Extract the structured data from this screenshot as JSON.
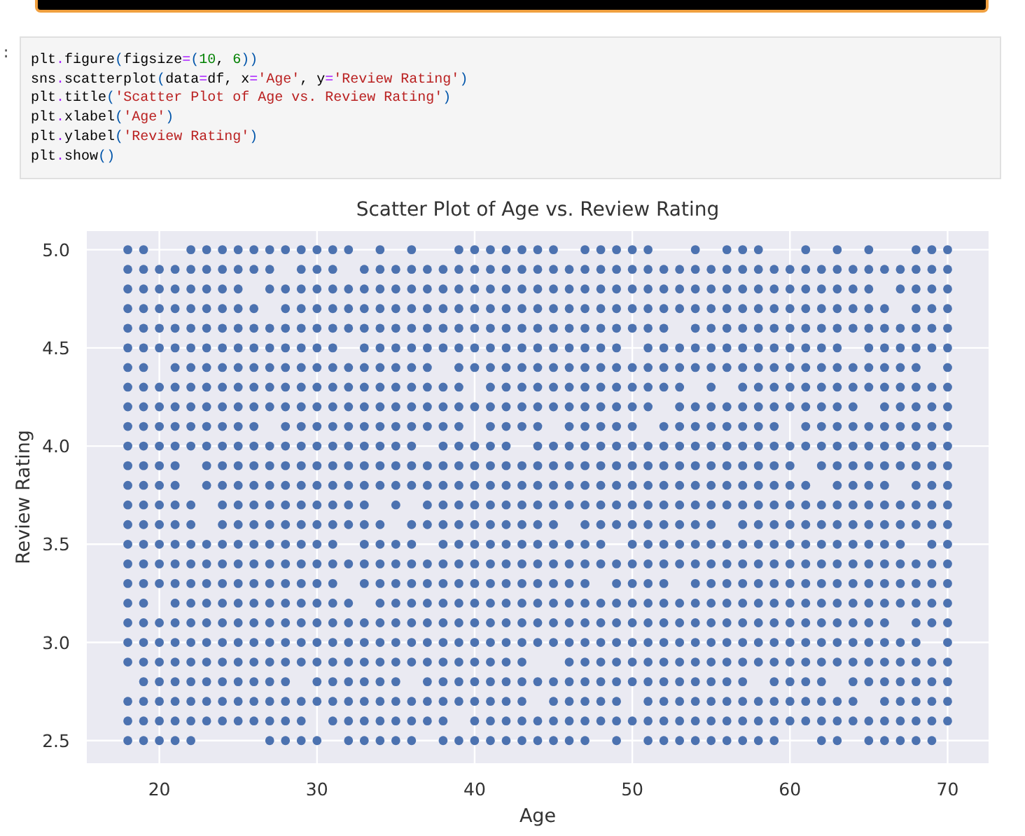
{
  "cell": {
    "prompt": ":",
    "code": [
      "plt.figure(figsize=(10, 6))",
      "sns.scatterplot(data=df, x='Age', y='Review Rating')",
      "plt.title('Scatter Plot of Age vs. Review Rating')",
      "plt.xlabel('Age')",
      "plt.ylabel('Review Rating')",
      "plt.show()"
    ]
  },
  "chart_data": {
    "type": "scatter",
    "title": "Scatter Plot of Age vs. Review Rating",
    "xlabel": "Age",
    "ylabel": "Review Rating",
    "x": [
      18,
      19,
      20,
      21,
      22,
      23,
      24,
      25,
      26,
      27,
      28,
      29,
      30,
      31,
      32,
      33,
      34,
      35,
      36,
      37,
      38,
      39,
      40,
      41,
      42,
      43,
      44,
      45,
      46,
      47,
      48,
      49,
      50,
      51,
      52,
      53,
      54,
      55,
      56,
      57,
      58,
      59,
      60,
      61,
      62,
      63,
      64,
      65,
      66,
      67,
      68,
      69,
      70
    ],
    "grid": true,
    "xlim": [
      15.4,
      72.6
    ],
    "ylim": [
      2.385,
      5.095
    ],
    "xticks": [
      20,
      30,
      40,
      50,
      60,
      70
    ],
    "yticks": [
      {
        "value": 2.5,
        "label": "2.5"
      },
      {
        "value": 3,
        "label": "3.0"
      },
      {
        "value": 3.5,
        "label": "3.5"
      },
      {
        "value": 4,
        "label": "4.0"
      },
      {
        "value": 4.5,
        "label": "4.5"
      },
      {
        "value": 5,
        "label": "5.0"
      }
    ],
    "series": [
      {
        "color": "#4c72b0",
        "values": [
          5,
          5,
          null,
          null,
          5,
          5,
          5,
          5,
          5,
          5,
          5,
          5,
          5,
          5,
          5,
          null,
          5,
          null,
          5,
          null,
          null,
          5,
          5,
          5,
          5,
          5,
          5,
          5,
          null,
          5,
          5,
          5,
          5,
          5,
          null,
          null,
          5,
          null,
          5,
          5,
          5,
          null,
          null,
          5,
          null,
          5,
          null,
          5,
          null,
          null,
          5,
          5,
          5
        ]
      },
      {
        "color": "#4c72b0",
        "values": [
          4.9,
          4.9,
          4.9,
          4.9,
          4.9,
          4.9,
          4.9,
          4.9,
          4.9,
          4.9,
          null,
          4.9,
          4.9,
          4.9,
          null,
          4.9,
          4.9,
          4.9,
          4.9,
          4.9,
          4.9,
          4.9,
          4.9,
          4.9,
          4.9,
          4.9,
          4.9,
          4.9,
          4.9,
          4.9,
          4.9,
          4.9,
          4.9,
          4.9,
          4.9,
          4.9,
          4.9,
          4.9,
          4.9,
          4.9,
          4.9,
          4.9,
          4.9,
          4.9,
          4.9,
          4.9,
          4.9,
          4.9,
          4.9,
          4.9,
          4.9,
          4.9,
          4.9
        ]
      },
      {
        "color": "#4c72b0",
        "values": [
          4.8,
          4.8,
          4.8,
          4.8,
          4.8,
          4.8,
          4.8,
          4.8,
          null,
          4.8,
          4.8,
          4.8,
          4.8,
          4.8,
          4.8,
          4.8,
          4.8,
          4.8,
          4.8,
          4.8,
          4.8,
          4.8,
          4.8,
          4.8,
          4.8,
          4.8,
          4.8,
          4.8,
          4.8,
          4.8,
          4.8,
          4.8,
          4.8,
          4.8,
          4.8,
          4.8,
          4.8,
          4.8,
          4.8,
          4.8,
          4.8,
          4.8,
          4.8,
          4.8,
          4.8,
          4.8,
          4.8,
          4.8,
          null,
          4.8,
          4.8,
          4.8,
          4.8
        ]
      },
      {
        "color": "#4c72b0",
        "values": [
          4.7,
          4.7,
          4.7,
          4.7,
          4.7,
          4.7,
          4.7,
          4.7,
          4.7,
          null,
          4.7,
          4.7,
          4.7,
          4.7,
          4.7,
          4.7,
          4.7,
          4.7,
          4.7,
          4.7,
          4.7,
          4.7,
          4.7,
          4.7,
          4.7,
          4.7,
          4.7,
          4.7,
          4.7,
          4.7,
          4.7,
          4.7,
          4.7,
          4.7,
          4.7,
          4.7,
          4.7,
          4.7,
          4.7,
          4.7,
          4.7,
          4.7,
          4.7,
          4.7,
          4.7,
          4.7,
          4.7,
          4.7,
          4.7,
          null,
          4.7,
          4.7,
          4.7
        ]
      },
      {
        "color": "#4c72b0",
        "values": [
          4.6,
          4.6,
          4.6,
          4.6,
          4.6,
          4.6,
          4.6,
          4.6,
          4.6,
          4.6,
          4.6,
          4.6,
          4.6,
          4.6,
          4.6,
          4.6,
          4.6,
          4.6,
          4.6,
          4.6,
          4.6,
          4.6,
          4.6,
          4.6,
          4.6,
          4.6,
          4.6,
          4.6,
          4.6,
          4.6,
          4.6,
          4.6,
          4.6,
          4.6,
          4.6,
          null,
          4.6,
          4.6,
          4.6,
          4.6,
          4.6,
          4.6,
          4.6,
          4.6,
          4.6,
          4.6,
          4.6,
          4.6,
          4.6,
          4.6,
          4.6,
          4.6,
          4.6
        ]
      },
      {
        "color": "#4c72b0",
        "values": [
          4.5,
          4.5,
          4.5,
          4.5,
          4.5,
          4.5,
          4.5,
          4.5,
          4.5,
          4.5,
          4.5,
          4.5,
          4.5,
          4.5,
          null,
          4.5,
          4.5,
          4.5,
          4.5,
          4.5,
          4.5,
          4.5,
          4.5,
          4.5,
          4.5,
          4.5,
          4.5,
          4.5,
          4.5,
          4.5,
          4.5,
          4.5,
          null,
          4.5,
          4.5,
          4.5,
          4.5,
          4.5,
          4.5,
          4.5,
          4.5,
          4.5,
          4.5,
          4.5,
          4.5,
          4.5,
          null,
          4.5,
          4.5,
          4.5,
          4.5,
          4.5,
          4.5
        ]
      },
      {
        "color": "#4c72b0",
        "values": [
          4.4,
          4.4,
          null,
          4.4,
          4.4,
          4.4,
          4.4,
          4.4,
          4.4,
          4.4,
          4.4,
          4.4,
          4.4,
          4.4,
          4.4,
          4.4,
          4.4,
          4.4,
          4.4,
          4.4,
          null,
          4.4,
          4.4,
          4.4,
          4.4,
          4.4,
          4.4,
          4.4,
          4.4,
          4.4,
          4.4,
          4.4,
          4.4,
          4.4,
          4.4,
          4.4,
          4.4,
          4.4,
          4.4,
          4.4,
          4.4,
          4.4,
          4.4,
          4.4,
          4.4,
          4.4,
          4.4,
          4.4,
          4.4,
          4.4,
          4.4,
          null,
          4.4
        ]
      },
      {
        "color": "#4c72b0",
        "values": [
          4.3,
          4.3,
          4.3,
          4.3,
          4.3,
          4.3,
          4.3,
          4.3,
          4.3,
          4.3,
          4.3,
          4.3,
          4.3,
          4.3,
          4.3,
          4.3,
          4.3,
          4.3,
          4.3,
          4.3,
          4.3,
          4.3,
          null,
          4.3,
          4.3,
          4.3,
          4.3,
          4.3,
          4.3,
          4.3,
          4.3,
          4.3,
          4.3,
          4.3,
          4.3,
          4.3,
          null,
          4.3,
          null,
          4.3,
          4.3,
          4.3,
          4.3,
          4.3,
          4.3,
          4.3,
          4.3,
          4.3,
          4.3,
          4.3,
          4.3,
          4.3,
          4.3
        ]
      },
      {
        "color": "#4c72b0",
        "values": [
          4.2,
          4.2,
          4.2,
          4.2,
          4.2,
          4.2,
          4.2,
          4.2,
          4.2,
          4.2,
          4.2,
          4.2,
          4.2,
          4.2,
          4.2,
          4.2,
          4.2,
          4.2,
          4.2,
          4.2,
          4.2,
          4.2,
          4.2,
          4.2,
          4.2,
          4.2,
          4.2,
          4.2,
          4.2,
          4.2,
          4.2,
          4.2,
          4.2,
          4.2,
          null,
          4.2,
          4.2,
          4.2,
          4.2,
          4.2,
          4.2,
          4.2,
          4.2,
          4.2,
          4.2,
          4.2,
          4.2,
          null,
          4.2,
          4.2,
          4.2,
          4.2,
          4.2
        ]
      },
      {
        "color": "#4c72b0",
        "values": [
          4.1,
          4.1,
          4.1,
          4.1,
          4.1,
          4.1,
          4.1,
          4.1,
          4.1,
          null,
          4.1,
          4.1,
          4.1,
          4.1,
          4.1,
          4.1,
          4.1,
          4.1,
          4.1,
          4.1,
          4.1,
          4.1,
          null,
          4.1,
          4.1,
          4.1,
          4.1,
          null,
          4.1,
          4.1,
          4.1,
          4.1,
          4.1,
          null,
          4.1,
          4.1,
          4.1,
          4.1,
          4.1,
          4.1,
          4.1,
          4.1,
          null,
          4.1,
          4.1,
          4.1,
          4.1,
          4.1,
          4.1,
          4.1,
          4.1,
          4.1,
          4.1
        ]
      },
      {
        "color": "#4c72b0",
        "values": [
          4,
          4,
          4,
          4,
          4,
          4,
          4,
          4,
          4,
          4,
          4,
          4,
          4,
          4,
          4,
          4,
          4,
          4,
          4,
          null,
          4,
          4,
          4,
          4,
          4,
          null,
          4,
          4,
          4,
          4,
          4,
          4,
          4,
          4,
          4,
          4,
          4,
          4,
          4,
          4,
          4,
          4,
          4,
          4,
          4,
          4,
          4,
          4,
          4,
          4,
          4,
          4,
          4
        ]
      },
      {
        "color": "#4c72b0",
        "values": [
          3.9,
          3.9,
          3.9,
          3.9,
          null,
          3.9,
          3.9,
          3.9,
          3.9,
          3.9,
          3.9,
          3.9,
          3.9,
          3.9,
          3.9,
          3.9,
          3.9,
          3.9,
          3.9,
          3.9,
          3.9,
          3.9,
          3.9,
          3.9,
          3.9,
          3.9,
          3.9,
          3.9,
          3.9,
          3.9,
          3.9,
          3.9,
          3.9,
          3.9,
          3.9,
          3.9,
          3.9,
          3.9,
          3.9,
          3.9,
          3.9,
          3.9,
          3.9,
          null,
          3.9,
          3.9,
          3.9,
          3.9,
          3.9,
          3.9,
          3.9,
          3.9,
          3.9
        ]
      },
      {
        "color": "#4c72b0",
        "values": [
          3.8,
          3.8,
          3.8,
          3.8,
          null,
          3.8,
          3.8,
          3.8,
          3.8,
          3.8,
          3.8,
          3.8,
          3.8,
          3.8,
          3.8,
          3.8,
          3.8,
          3.8,
          3.8,
          3.8,
          3.8,
          3.8,
          3.8,
          3.8,
          3.8,
          3.8,
          3.8,
          3.8,
          3.8,
          3.8,
          3.8,
          3.8,
          3.8,
          3.8,
          3.8,
          3.8,
          3.8,
          3.8,
          3.8,
          3.8,
          3.8,
          3.8,
          3.8,
          3.8,
          null,
          3.8,
          3.8,
          3.8,
          3.8,
          null,
          3.8,
          3.8,
          3.8
        ]
      },
      {
        "color": "#4c72b0",
        "values": [
          3.7,
          3.7,
          3.7,
          3.7,
          3.7,
          null,
          3.7,
          3.7,
          3.7,
          3.7,
          3.7,
          3.7,
          3.7,
          3.7,
          3.7,
          3.7,
          null,
          3.7,
          null,
          3.7,
          3.7,
          3.7,
          3.7,
          3.7,
          3.7,
          3.7,
          3.7,
          3.7,
          3.7,
          3.7,
          3.7,
          3.7,
          3.7,
          3.7,
          3.7,
          3.7,
          3.7,
          3.7,
          3.7,
          3.7,
          3.7,
          3.7,
          3.7,
          3.7,
          3.7,
          3.7,
          3.7,
          3.7,
          3.7,
          3.7,
          3.7,
          3.7,
          3.7
        ]
      },
      {
        "color": "#4c72b0",
        "values": [
          3.6,
          3.6,
          3.6,
          3.6,
          3.6,
          null,
          3.6,
          3.6,
          3.6,
          3.6,
          3.6,
          3.6,
          3.6,
          3.6,
          3.6,
          3.6,
          3.6,
          null,
          3.6,
          3.6,
          3.6,
          3.6,
          3.6,
          3.6,
          3.6,
          3.6,
          3.6,
          3.6,
          null,
          3.6,
          3.6,
          3.6,
          3.6,
          3.6,
          3.6,
          3.6,
          3.6,
          3.6,
          null,
          3.6,
          3.6,
          3.6,
          3.6,
          3.6,
          3.6,
          3.6,
          3.6,
          3.6,
          3.6,
          3.6,
          3.6,
          3.6,
          3.6
        ]
      },
      {
        "color": "#4c72b0",
        "values": [
          3.5,
          3.5,
          3.5,
          3.5,
          3.5,
          3.5,
          3.5,
          3.5,
          3.5,
          3.5,
          3.5,
          3.5,
          3.5,
          3.5,
          null,
          3.5,
          3.5,
          3.5,
          3.5,
          null,
          3.5,
          3.5,
          3.5,
          3.5,
          3.5,
          3.5,
          3.5,
          3.5,
          3.5,
          3.5,
          3.5,
          null,
          3.5,
          3.5,
          3.5,
          3.5,
          3.5,
          3.5,
          3.5,
          3.5,
          3.5,
          3.5,
          3.5,
          3.5,
          3.5,
          3.5,
          3.5,
          3.5,
          3.5,
          3.5,
          null,
          3.5,
          3.5
        ]
      },
      {
        "color": "#4c72b0",
        "values": [
          3.4,
          3.4,
          3.4,
          3.4,
          3.4,
          3.4,
          3.4,
          3.4,
          3.4,
          3.4,
          3.4,
          3.4,
          3.4,
          3.4,
          3.4,
          3.4,
          3.4,
          3.4,
          3.4,
          3.4,
          3.4,
          3.4,
          3.4,
          3.4,
          3.4,
          3.4,
          3.4,
          3.4,
          3.4,
          3.4,
          3.4,
          3.4,
          3.4,
          3.4,
          3.4,
          3.4,
          3.4,
          3.4,
          3.4,
          3.4,
          3.4,
          3.4,
          3.4,
          3.4,
          3.4,
          3.4,
          3.4,
          3.4,
          3.4,
          3.4,
          3.4,
          3.4,
          3.4
        ]
      },
      {
        "color": "#4c72b0",
        "values": [
          3.3,
          3.3,
          3.3,
          3.3,
          3.3,
          3.3,
          3.3,
          3.3,
          3.3,
          3.3,
          3.3,
          3.3,
          3.3,
          3.3,
          null,
          3.3,
          3.3,
          3.3,
          3.3,
          3.3,
          3.3,
          3.3,
          3.3,
          3.3,
          3.3,
          3.3,
          3.3,
          3.3,
          3.3,
          3.3,
          null,
          3.3,
          3.3,
          3.3,
          3.3,
          null,
          3.3,
          3.3,
          3.3,
          3.3,
          3.3,
          3.3,
          3.3,
          3.3,
          3.3,
          3.3,
          3.3,
          3.3,
          3.3,
          3.3,
          3.3,
          3.3,
          3.3
        ]
      },
      {
        "color": "#4c72b0",
        "values": [
          3.2,
          3.2,
          null,
          3.2,
          3.2,
          3.2,
          3.2,
          3.2,
          3.2,
          3.2,
          3.2,
          3.2,
          3.2,
          3.2,
          3.2,
          null,
          3.2,
          3.2,
          3.2,
          3.2,
          3.2,
          3.2,
          3.2,
          3.2,
          3.2,
          3.2,
          3.2,
          3.2,
          3.2,
          3.2,
          3.2,
          3.2,
          3.2,
          3.2,
          3.2,
          3.2,
          3.2,
          3.2,
          3.2,
          3.2,
          3.2,
          3.2,
          3.2,
          3.2,
          3.2,
          3.2,
          3.2,
          3.2,
          3.2,
          3.2,
          3.2,
          3.2,
          3.2
        ]
      },
      {
        "color": "#4c72b0",
        "values": [
          3.1,
          3.1,
          3.1,
          3.1,
          3.1,
          3.1,
          3.1,
          3.1,
          3.1,
          3.1,
          3.1,
          3.1,
          3.1,
          3.1,
          3.1,
          3.1,
          3.1,
          3.1,
          3.1,
          3.1,
          3.1,
          3.1,
          3.1,
          3.1,
          3.1,
          3.1,
          3.1,
          3.1,
          3.1,
          3.1,
          3.1,
          3.1,
          3.1,
          3.1,
          3.1,
          3.1,
          3.1,
          3.1,
          3.1,
          3.1,
          3.1,
          3.1,
          3.1,
          3.1,
          3.1,
          3.1,
          3.1,
          3.1,
          3.1,
          null,
          3.1,
          3.1,
          3.1
        ]
      },
      {
        "color": "#4c72b0",
        "values": [
          3,
          3,
          3,
          3,
          3,
          3,
          3,
          3,
          3,
          3,
          3,
          3,
          3,
          3,
          3,
          3,
          3,
          3,
          3,
          3,
          3,
          3,
          3,
          3,
          3,
          3,
          3,
          3,
          3,
          3,
          3,
          3,
          3,
          3,
          3,
          3,
          3,
          3,
          3,
          3,
          3,
          3,
          3,
          3,
          3,
          3,
          3,
          3,
          3,
          3,
          3,
          null,
          3
        ]
      },
      {
        "color": "#4c72b0",
        "values": [
          2.9,
          2.9,
          2.9,
          2.9,
          2.9,
          2.9,
          2.9,
          2.9,
          2.9,
          2.9,
          2.9,
          2.9,
          2.9,
          2.9,
          2.9,
          2.9,
          2.9,
          2.9,
          2.9,
          2.9,
          2.9,
          2.9,
          2.9,
          2.9,
          2.9,
          2.9,
          null,
          null,
          2.9,
          2.9,
          2.9,
          2.9,
          2.9,
          2.9,
          2.9,
          2.9,
          2.9,
          2.9,
          2.9,
          2.9,
          2.9,
          2.9,
          2.9,
          2.9,
          2.9,
          2.9,
          2.9,
          2.9,
          2.9,
          2.9,
          2.9,
          2.9,
          2.9
        ]
      },
      {
        "color": "#4c72b0",
        "values": [
          null,
          2.8,
          2.8,
          2.8,
          2.8,
          2.8,
          2.8,
          2.8,
          2.8,
          2.8,
          2.8,
          null,
          2.8,
          2.8,
          2.8,
          2.8,
          2.8,
          2.8,
          null,
          2.8,
          2.8,
          2.8,
          2.8,
          2.8,
          2.8,
          2.8,
          2.8,
          2.8,
          2.8,
          2.8,
          2.8,
          2.8,
          2.8,
          2.8,
          2.8,
          2.8,
          2.8,
          2.8,
          2.8,
          2.8,
          null,
          2.8,
          2.8,
          2.8,
          2.8,
          null,
          2.8,
          2.8,
          2.8,
          2.8,
          2.8,
          2.8,
          2.8
        ]
      },
      {
        "color": "#4c72b0",
        "values": [
          2.7,
          2.7,
          2.7,
          2.7,
          2.7,
          2.7,
          2.7,
          2.7,
          2.7,
          2.7,
          2.7,
          2.7,
          2.7,
          2.7,
          2.7,
          2.7,
          2.7,
          2.7,
          2.7,
          2.7,
          2.7,
          2.7,
          2.7,
          2.7,
          2.7,
          2.7,
          null,
          2.7,
          2.7,
          2.7,
          2.7,
          2.7,
          null,
          2.7,
          2.7,
          2.7,
          2.7,
          2.7,
          2.7,
          2.7,
          2.7,
          2.7,
          2.7,
          2.7,
          2.7,
          2.7,
          2.7,
          null,
          2.7,
          2.7,
          2.7,
          2.7,
          2.7
        ]
      },
      {
        "color": "#4c72b0",
        "values": [
          2.6,
          2.6,
          2.6,
          2.6,
          2.6,
          2.6,
          2.6,
          2.6,
          2.6,
          2.6,
          2.6,
          2.6,
          null,
          2.6,
          2.6,
          2.6,
          2.6,
          2.6,
          2.6,
          2.6,
          2.6,
          null,
          2.6,
          2.6,
          2.6,
          2.6,
          2.6,
          2.6,
          2.6,
          2.6,
          2.6,
          2.6,
          2.6,
          2.6,
          2.6,
          2.6,
          2.6,
          2.6,
          2.6,
          2.6,
          2.6,
          2.6,
          2.6,
          2.6,
          2.6,
          2.6,
          2.6,
          2.6,
          2.6,
          2.6,
          2.6,
          2.6,
          2.6
        ]
      },
      {
        "color": "#4c72b0",
        "values": [
          2.5,
          2.5,
          2.5,
          2.5,
          2.5,
          null,
          null,
          null,
          null,
          2.5,
          2.5,
          2.5,
          2.5,
          null,
          2.5,
          2.5,
          2.5,
          2.5,
          2.5,
          null,
          2.5,
          2.5,
          2.5,
          2.5,
          2.5,
          2.5,
          2.5,
          2.5,
          2.5,
          2.5,
          null,
          2.5,
          null,
          2.5,
          2.5,
          2.5,
          2.5,
          2.5,
          2.5,
          2.5,
          2.5,
          2.5,
          null,
          null,
          2.5,
          2.5,
          null,
          2.5,
          2.5,
          2.5,
          2.5,
          2.5,
          null
        ]
      }
    ]
  }
}
